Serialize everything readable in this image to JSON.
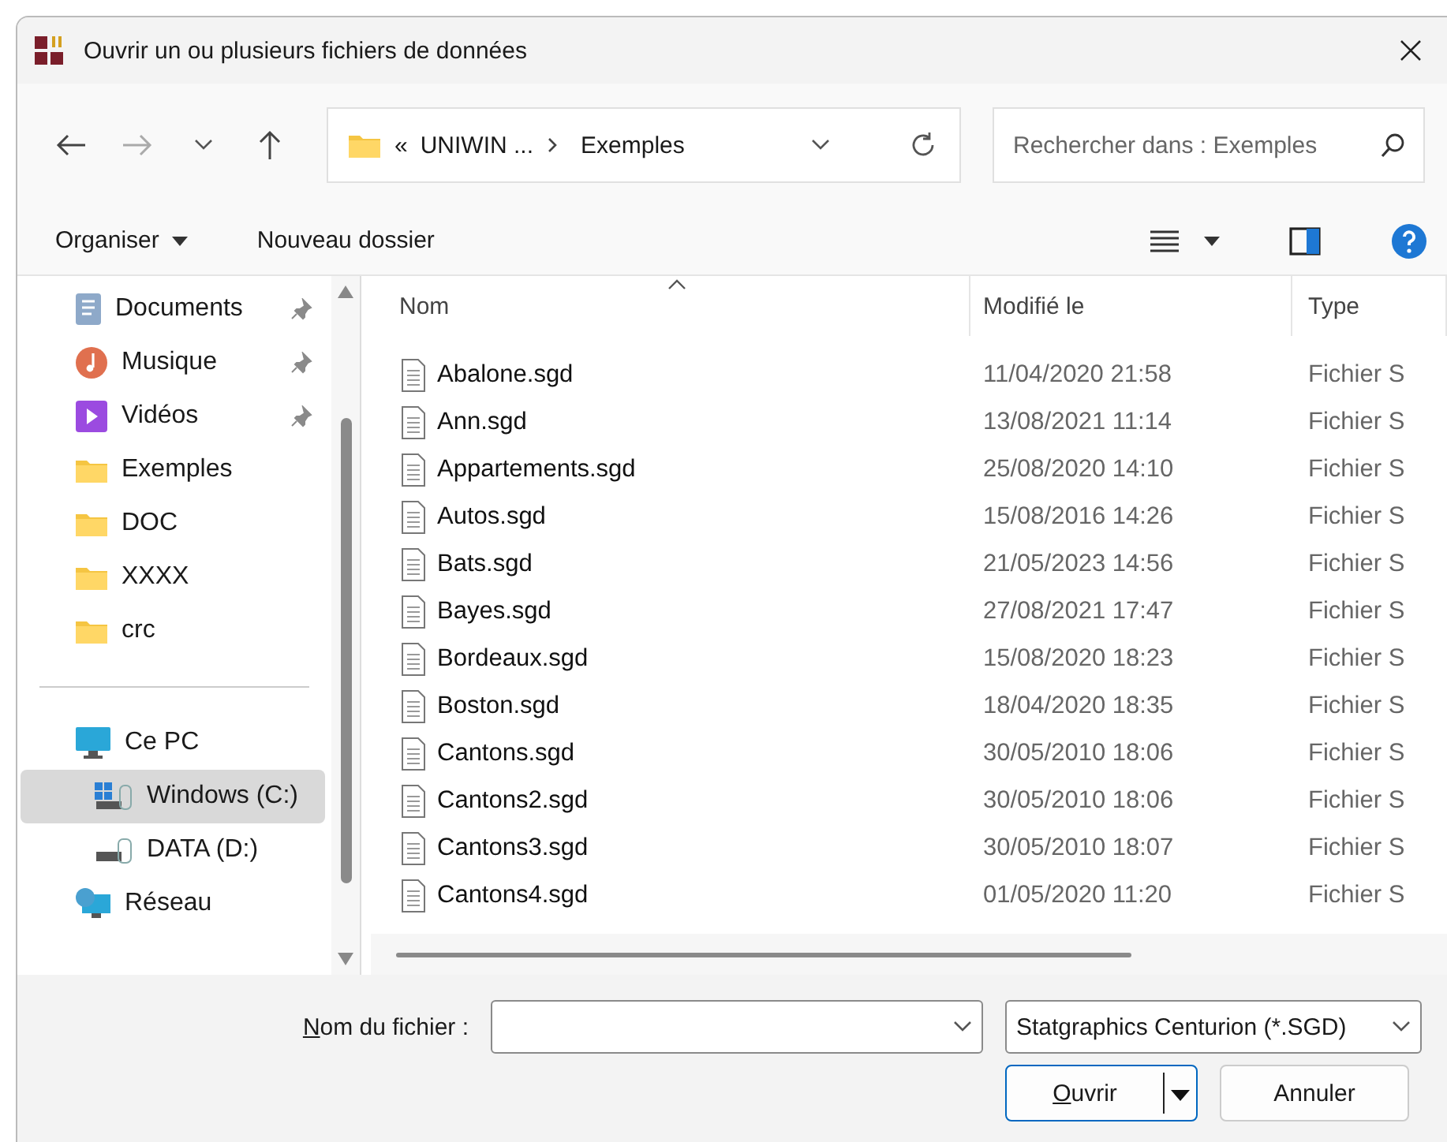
{
  "window": {
    "title": "Ouvrir un ou plusieurs fichiers de données"
  },
  "address": {
    "overflow": "«",
    "path": [
      {
        "label": "UNIWIN ..."
      },
      {
        "label": "Exemples"
      }
    ]
  },
  "search": {
    "placeholder": "Rechercher dans : Exemples"
  },
  "commands": {
    "organise": "Organiser",
    "new_folder": "Nouveau dossier"
  },
  "sidebar": {
    "quick_access": [
      {
        "label": "Documents",
        "kind": "documents",
        "pinned": true
      },
      {
        "label": "Musique",
        "kind": "music",
        "pinned": true
      },
      {
        "label": "Vidéos",
        "kind": "videos",
        "pinned": true
      },
      {
        "label": "Exemples",
        "kind": "folder",
        "pinned": false
      },
      {
        "label": "DOC",
        "kind": "folder",
        "pinned": false
      },
      {
        "label": "XXXX",
        "kind": "folder",
        "pinned": false
      },
      {
        "label": "crc",
        "kind": "folder",
        "pinned": false
      }
    ],
    "tree": [
      {
        "label": "Ce PC",
        "kind": "pc",
        "selected": false,
        "children": [
          {
            "label": "Windows (C:)",
            "kind": "system",
            "selected": true
          },
          {
            "label": "DATA (D:)",
            "kind": "drive",
            "selected": false
          }
        ]
      },
      {
        "label": "Réseau",
        "kind": "network",
        "selected": false
      }
    ]
  },
  "table": {
    "columns": [
      "Nom",
      "Modifié le",
      "Type"
    ],
    "rows": [
      {
        "name": "Abalone.sgd",
        "modified": "11/04/2020 21:58",
        "type": "Fichier S"
      },
      {
        "name": "Ann.sgd",
        "modified": "13/08/2021 11:14",
        "type": "Fichier S"
      },
      {
        "name": "Appartements.sgd",
        "modified": "25/08/2020 14:10",
        "type": "Fichier S"
      },
      {
        "name": "Autos.sgd",
        "modified": "15/08/2016 14:26",
        "type": "Fichier S"
      },
      {
        "name": "Bats.sgd",
        "modified": "21/05/2023 14:56",
        "type": "Fichier S"
      },
      {
        "name": "Bayes.sgd",
        "modified": "27/08/2021 17:47",
        "type": "Fichier S"
      },
      {
        "name": "Bordeaux.sgd",
        "modified": "15/08/2020 18:23",
        "type": "Fichier S"
      },
      {
        "name": "Boston.sgd",
        "modified": "18/04/2020 18:35",
        "type": "Fichier S"
      },
      {
        "name": "Cantons.sgd",
        "modified": "30/05/2010 18:06",
        "type": "Fichier S"
      },
      {
        "name": "Cantons2.sgd",
        "modified": "30/05/2010 18:06",
        "type": "Fichier S"
      },
      {
        "name": "Cantons3.sgd",
        "modified": "30/05/2010 18:07",
        "type": "Fichier S"
      },
      {
        "name": "Cantons4.sgd",
        "modified": "01/05/2020 11:20",
        "type": "Fichier S"
      }
    ]
  },
  "footer": {
    "filename_label": "Nom du fichier :",
    "filter": "Statgraphics Centurion (*.SGD)",
    "open": "Ouvrir",
    "cancel": "Annuler"
  }
}
